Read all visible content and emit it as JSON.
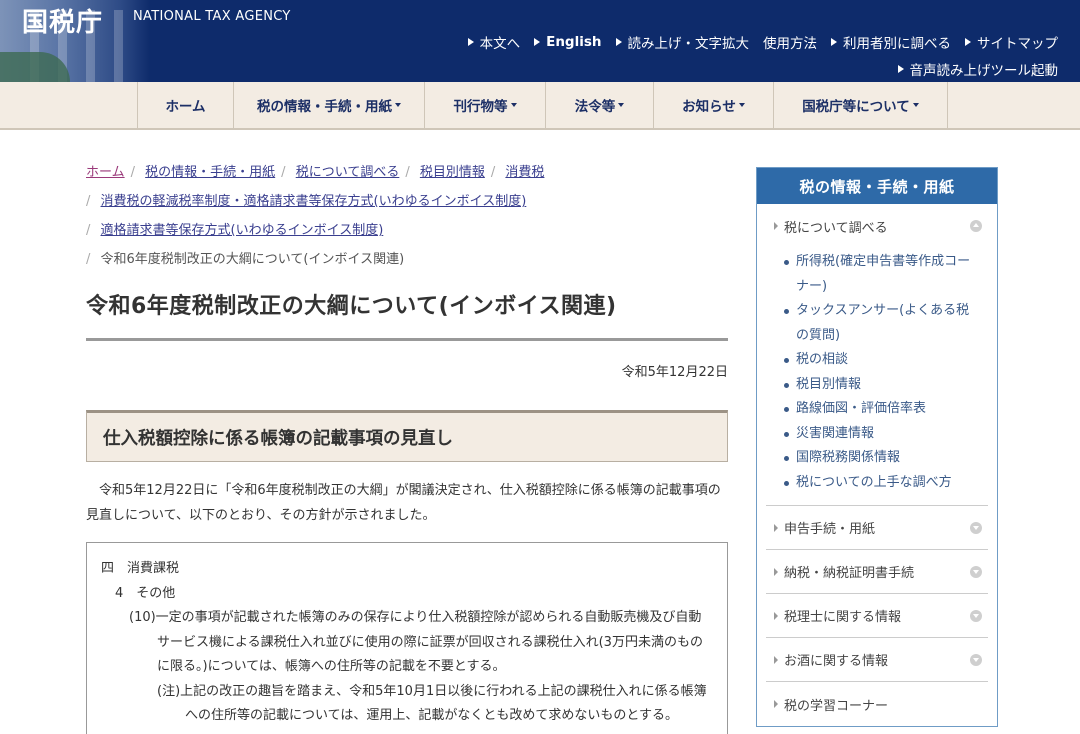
{
  "header": {
    "logo_jp": "国税庁",
    "logo_en": "NATIONAL TAX AGENCY",
    "util_links": [
      "本文へ",
      "English",
      "読み上げ・文字拡大",
      "使用方法",
      "利用者別に調べる",
      "サイトマップ"
    ],
    "voice_tool": "音声読み上げツール起動"
  },
  "nav": {
    "items": [
      "ホーム",
      "税の情報・手続・用紙",
      "刊行物等",
      "法令等",
      "お知らせ",
      "国税庁等について"
    ]
  },
  "breadcrumb": {
    "home": "ホーム",
    "c1": "税の情報・手続・用紙",
    "c2": "税について調べる",
    "c3": "税目別情報",
    "c4": "消費税",
    "c5": "消費税の軽減税率制度・適格請求書等保存方式(いわゆるインボイス制度)",
    "c6": "適格請求書等保存方式(いわゆるインボイス制度)",
    "current": "令和6年度税制改正の大綱について(インボイス関連)"
  },
  "page": {
    "title": "令和6年度税制改正の大綱について(インボイス関連)",
    "date": "令和5年12月22日",
    "section_heading": "仕入税額控除に係る帳簿の記載事項の見直し",
    "intro": "令和5年12月22日に「令和6年度税制改正の大綱」が閣議決定され、仕入税額控除に係る帳簿の記載事項の見直しについて、以下のとおり、その方針が示されました。",
    "quote": {
      "l1": "四　消費課税",
      "l2": "4　その他",
      "l3": "(10)一定の事項が記載された帳簿のみの保存により仕入税額控除が認められる自動販売機及び自動サービス機による課税仕入れ並びに使用の際に証票が回収される課税仕入れ(3万円未満のものに限る。)については、帳簿への住所等の記載を不要とする。",
      "l4": "(注)上記の改正の趣旨を踏まえ、令和5年10月1日以後に行われる上記の課税仕入れに係る帳簿への住所等の記載については、運用上、記載がなくとも改めて求めないものとする。"
    }
  },
  "sidebar": {
    "title": "税の情報・手続・用紙",
    "open_category": "税について調べる",
    "links": [
      "所得税(確定申告書等作成コーナー)",
      "タックスアンサー(よくある税の質問)",
      "税の相談",
      "税目別情報",
      "路線価図・評価倍率表",
      "災害関連情報",
      "国際税務関係情報",
      "税についての上手な調べ方"
    ],
    "categories": [
      "申告手続・用紙",
      "納税・納税証明書手続",
      "税理士に関する情報",
      "お酒に関する情報",
      "税の学習コーナー"
    ]
  }
}
